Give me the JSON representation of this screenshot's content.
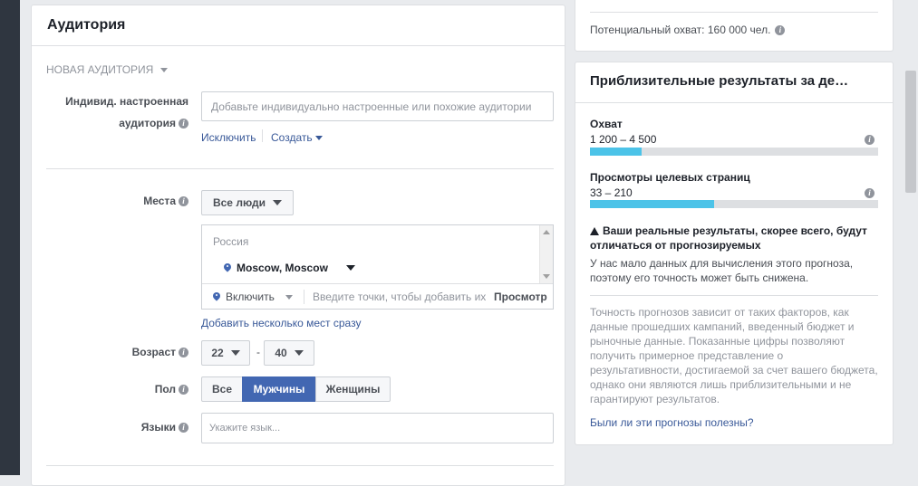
{
  "main": {
    "title": "Аудитория",
    "section_label": "НОВАЯ АУДИТОРИЯ",
    "custom_aud": {
      "label_line1": "Индивид. настроенная",
      "label_line2": "аудитория",
      "placeholder": "Добавьте индивидуально настроенные или похожие аудитории",
      "exclude": "Исключить",
      "create": "Создать"
    },
    "places": {
      "label": "Места",
      "dropdown": "Все люди",
      "country": "Россия",
      "city": "Moscow, Moscow",
      "include": "Включить",
      "search_placeholder": "Введите точки, чтобы добавить их",
      "browse": "Просмотр",
      "add_many": "Добавить несколько мест сразу"
    },
    "age": {
      "label": "Возраст",
      "from": "22",
      "dash": "-",
      "to": "40"
    },
    "gender": {
      "label": "Пол",
      "all": "Все",
      "men": "Мужчины",
      "women": "Женщины",
      "selected": "Мужчины"
    },
    "languages": {
      "label": "Языки",
      "placeholder": "Укажите язык..."
    }
  },
  "right": {
    "potential_reach": "Потенциальный охват: 160 000 чел.",
    "results_title": "Приблизительные результаты за де…",
    "reach": {
      "label": "Охват",
      "range": "1 200 – 4 500",
      "fill": 0.18
    },
    "views": {
      "label": "Просмотры целевых страниц",
      "range": "33 – 210",
      "fill": 0.43
    },
    "warning_title": "Ваши реальные результаты, скорее всего, будут отличаться от прогнозируемых",
    "warning_text": "У нас мало данных для вычисления этого прогноза, поэтому его точность может быть снижена.",
    "accuracy_text": "Точность прогнозов зависит от таких факторов, как данные прошедших кампаний, введенный бюджет и рыночные данные. Показанные цифры позволяют получить примерное представление о результативности, достигаемой за счет вашего бюджета, однако они являются лишь приблизительными и не гарантируют результатов.",
    "feedback_link": "Были ли эти прогнозы полезны?"
  },
  "icons": {
    "info": "info-icon",
    "pin": "location-pin-icon",
    "warning": "warning-icon",
    "caret": "caret-down-icon"
  }
}
